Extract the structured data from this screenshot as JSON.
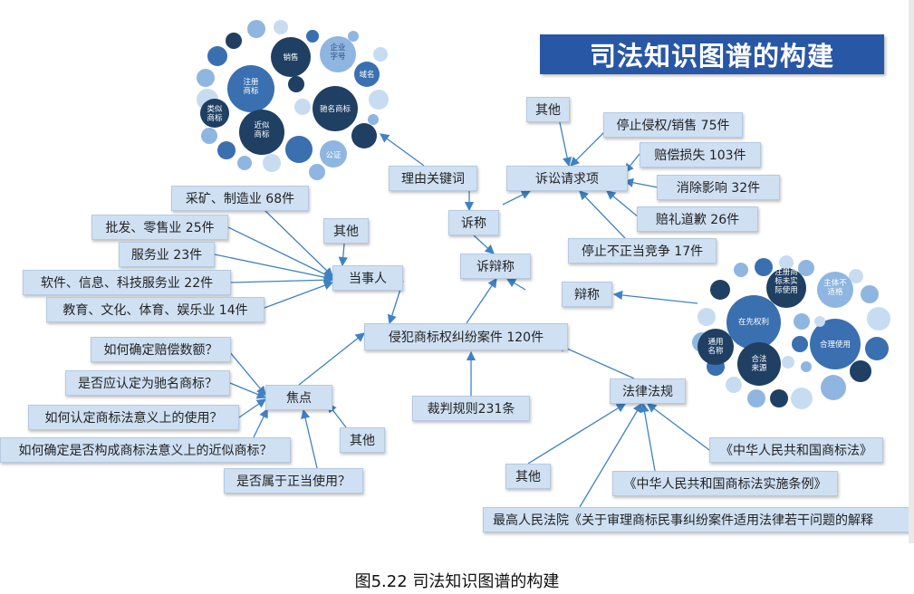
{
  "title": "司法知识图谱的构建",
  "caption": "图5.22 司法知识图谱的构建",
  "colors": {
    "banner": "#2857a6",
    "box": "#cfe0f3",
    "line": "#3f82c4",
    "dark": "#1f3f63",
    "mid": "#3a6fb0",
    "light": "#8fb6e0",
    "pale": "#c7dcf1"
  },
  "nodes": {
    "core": "侵犯商标权纠纷案件 120件",
    "defense": "诉辩称",
    "claim": "诉称",
    "reason_keyword": "理由关键词",
    "litigation_request": "诉讼请求项",
    "req_other": "其他",
    "req_stop_infringe": "停止侵权/销售 75件",
    "req_compensation": "赔偿损失 103件",
    "req_eliminate_effect": "消除影响 32件",
    "req_apology": "赔礼道歉 26件",
    "req_stop_unfair": "停止不正当竞争 17件",
    "respond": "辩称",
    "party": "当事人",
    "party_other": "其他",
    "party_mining": "采矿、制造业 68件",
    "party_wholesale": "批发、零售业 25件",
    "party_service": "服务业 23件",
    "party_software": "软件、信息、科技服务业 22件",
    "party_education": "教育、文化、体育、娱乐业 14件",
    "focus": "焦点",
    "focus_other": "其他",
    "focus_q1": "如何确定赔偿数额？",
    "focus_q2": "是否应认定为驰名商标？",
    "focus_q3": "如何认定商标法意义上的使用？",
    "focus_q4": "如何确定是否构成商标法意义上的近似商标？",
    "focus_q5": "是否属于正当使用？",
    "rules": "裁判规则231条",
    "law": "法律法规",
    "law_other": "其他",
    "law_trademark": "《中华人民共和国商标法》",
    "law_implementation": "《中华人民共和国商标法实施条例》",
    "law_interpretation": "最高人民法院《关于审理商标民事纠纷案件适用法律若干问题的解释"
  },
  "cluster_left": {
    "labels": [
      "销售",
      "企业\n字号",
      "域名",
      "注册\n商标",
      "驰名商标",
      "类似\n商标",
      "近似\n商标",
      "公证"
    ]
  },
  "cluster_right": {
    "labels": [
      "注册商\n标未实\n际使用",
      "主体不\n适格",
      "在先权利",
      "合理使用",
      "通用\n名称",
      "合法\n来源"
    ]
  }
}
